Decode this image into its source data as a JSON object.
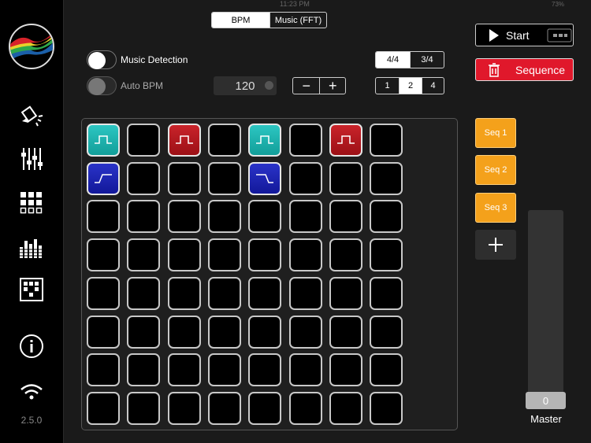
{
  "status_bar": {
    "time": "11:23 PM",
    "battery": "73%"
  },
  "sidebar": {
    "logo": "rainbow-wave-logo",
    "items": [
      {
        "icon": "paint-bucket-icon"
      },
      {
        "icon": "mixer-sliders-icon"
      },
      {
        "icon": "grid-icon"
      },
      {
        "icon": "equalizer-bars-icon"
      },
      {
        "icon": "sequence-grid-icon"
      },
      {
        "icon": "info-icon"
      },
      {
        "icon": "wifi-icon"
      }
    ],
    "version": "2.5.0"
  },
  "mode_tabs": {
    "options": [
      "BPM",
      "Music (FFT)"
    ],
    "selected": "BPM"
  },
  "music_detection": {
    "label": "Music Detection",
    "on": false
  },
  "auto_bpm": {
    "label": "Auto BPM",
    "on": false
  },
  "bpm": {
    "value": "120",
    "minus": "−",
    "plus": "+"
  },
  "time_signature": {
    "options": [
      "4/4",
      "3/4"
    ],
    "selected": "4/4"
  },
  "subdivision": {
    "options": [
      "1",
      "2",
      "4"
    ],
    "selected": "2"
  },
  "start_button": {
    "label": "Start"
  },
  "sequence_button": {
    "label": "Sequence"
  },
  "sequences": [
    {
      "label": "Seq 1"
    },
    {
      "label": "Seq 2"
    },
    {
      "label": "Seq 3"
    }
  ],
  "add_sequence": "+",
  "master": {
    "value": "0",
    "label": "Master"
  },
  "colors": {
    "teal": "#1db3af",
    "red": "#b81a20",
    "blue": "#1d24b5",
    "orange": "#f4a11b",
    "sequence_red": "#e0182b"
  },
  "grid": {
    "rows": 8,
    "cols": 8,
    "cells": [
      {
        "row": 0,
        "col": 0,
        "color": "teal",
        "pattern": "square-pulse"
      },
      {
        "row": 0,
        "col": 2,
        "color": "red",
        "pattern": "square-pulse"
      },
      {
        "row": 0,
        "col": 4,
        "color": "teal",
        "pattern": "square-pulse"
      },
      {
        "row": 0,
        "col": 6,
        "color": "red",
        "pattern": "square-pulse"
      },
      {
        "row": 1,
        "col": 0,
        "color": "blue",
        "pattern": "ramp-up"
      },
      {
        "row": 1,
        "col": 4,
        "color": "blue",
        "pattern": "ramp-down"
      }
    ]
  }
}
